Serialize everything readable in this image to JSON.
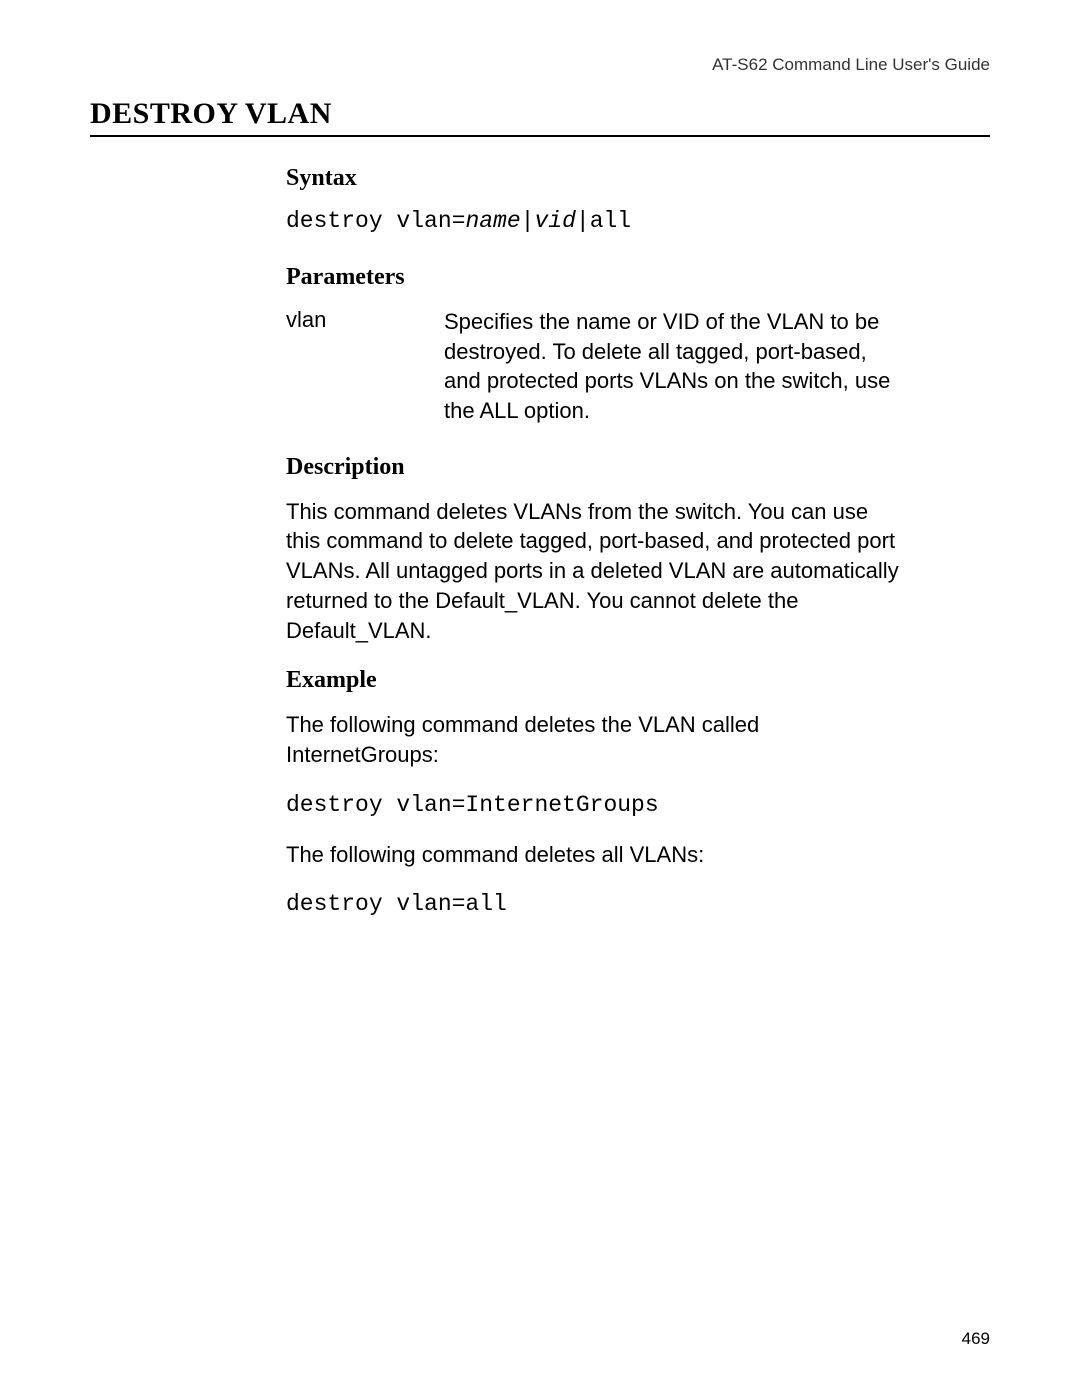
{
  "header": {
    "guide": "AT-S62 Command Line User's Guide"
  },
  "title": "DESTROY VLAN",
  "sections": {
    "syntax": {
      "heading": "Syntax",
      "cmd_prefix": "destroy vlan=",
      "cmd_arg1": "name",
      "cmd_pipe1": "|",
      "cmd_arg2": "vid",
      "cmd_pipe2": "|",
      "cmd_tail": "all"
    },
    "parameters": {
      "heading": "Parameters",
      "rows": [
        {
          "name": "vlan",
          "desc": "Specifies the name or VID of the VLAN to be destroyed. To delete all tagged, port-based, and protected ports VLANs on the switch, use the ALL option."
        }
      ]
    },
    "description": {
      "heading": "Description",
      "body": "This command deletes VLANs from the switch. You can use this command to delete tagged, port-based, and protected port VLANs. All untagged ports in a deleted VLAN are automatically returned to the Default_VLAN. You cannot delete the Default_VLAN."
    },
    "example": {
      "heading": "Example",
      "intro1": "The following command deletes the VLAN called InternetGroups:",
      "code1": "destroy vlan=InternetGroups",
      "intro2": "The following command deletes all VLANs:",
      "code2": "destroy vlan=all"
    }
  },
  "page_number": "469"
}
